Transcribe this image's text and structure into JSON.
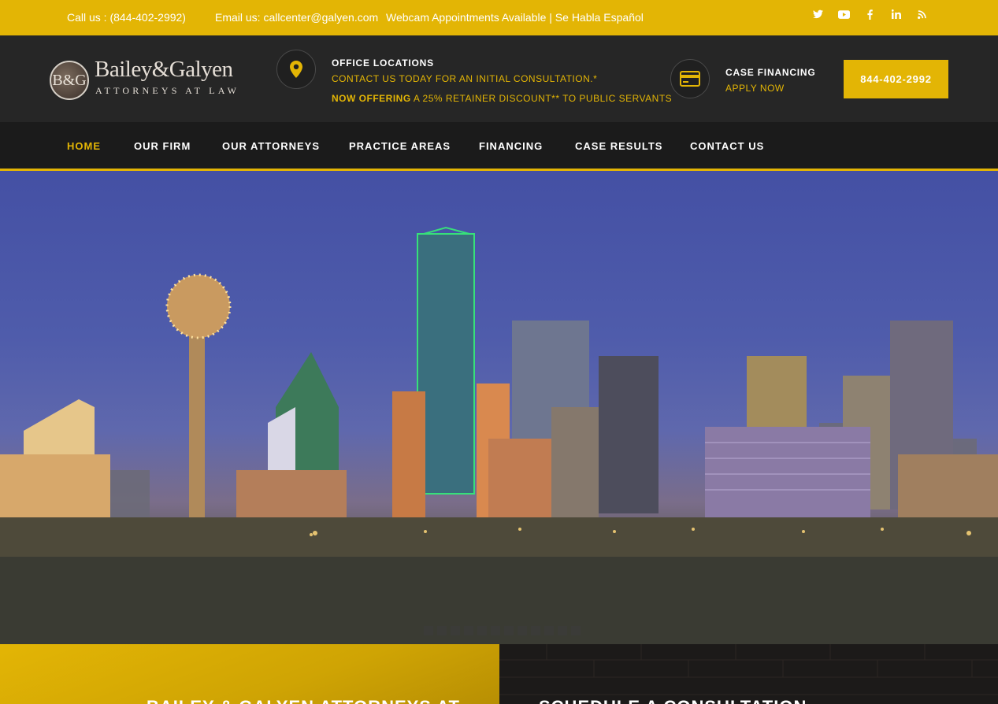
{
  "topbar": {
    "call": "Call us : (844-402-2992)",
    "email": "Email us: callcenter@galyen.com",
    "notice": "Webcam Appointments Available | Se Habla Español",
    "social_icons": [
      "twitter-icon",
      "youtube-icon",
      "facebook-icon",
      "linkedin-icon",
      "rss-icon"
    ]
  },
  "logo": {
    "monogram": "B&G",
    "name": "Bailey&Galyen",
    "subtitle": "ATTORNEYS AT LAW"
  },
  "office": {
    "title": "OFFICE LOCATIONS",
    "line1": "CONTACT US TODAY FOR AN INITIAL CONSULTATION.*",
    "offer_bold": "NOW OFFERING",
    "offer_rest": " A 25% RETAINER DISCOUNT** TO PUBLIC SERVANTS"
  },
  "financing": {
    "title": "CASE FINANCING",
    "link": "APPLY NOW"
  },
  "phone_button": "844-402-2992",
  "nav": [
    {
      "label": "HOME",
      "active": true
    },
    {
      "label": "OUR FIRM",
      "active": false
    },
    {
      "label": "OUR ATTORNEYS",
      "active": false
    },
    {
      "label": "PRACTICE AREAS",
      "active": false
    },
    {
      "label": "FINANCING",
      "active": false
    },
    {
      "label": "CASE RESULTS",
      "active": false
    },
    {
      "label": "CONTACT US",
      "active": false
    }
  ],
  "hero": {
    "slide_count": 12
  },
  "panels": {
    "left_heading": "BAILEY & GALYEN ATTORNEYS AT",
    "right_heading": "SCHEDULE A CONSULTATION"
  },
  "colors": {
    "accent": "#e3b505",
    "header_bg": "#262626",
    "nav_bg": "#1b1b1b"
  }
}
